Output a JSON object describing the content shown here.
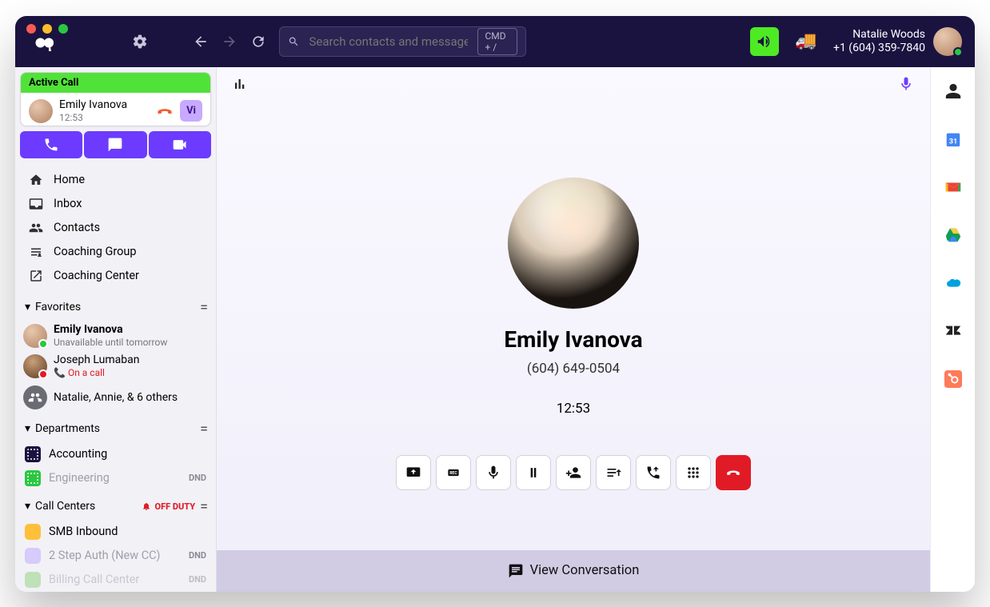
{
  "topbar": {
    "search_placeholder": "Search contacts and messages",
    "shortcut": "CMD + /",
    "user_name": "Natalie Woods",
    "user_phone": "+1 (604) 359-7840"
  },
  "active_call": {
    "header": "Active Call",
    "name": "Emily Ivanova",
    "duration": "12:53",
    "chip": "Vi"
  },
  "nav": {
    "home": "Home",
    "inbox": "Inbox",
    "contacts": "Contacts",
    "coaching_group": "Coaching Group",
    "coaching_center": "Coaching Center"
  },
  "sections": {
    "favorites": "Favorites",
    "departments": "Departments",
    "call_centers": "Call Centers",
    "off_duty": "OFF DUTY"
  },
  "favorites": [
    {
      "name": "Emily Ivanova",
      "sub": "Unavailable until tomorrow",
      "bold": true,
      "presence": "green"
    },
    {
      "name": "Joseph Lumaban",
      "sub": "On a call",
      "sub_red": true,
      "presence": "red"
    },
    {
      "name": "Natalie, Annie, & 6 others",
      "group": true
    }
  ],
  "departments": [
    {
      "name": "Accounting",
      "color": "#1a1340"
    },
    {
      "name": "Engineering",
      "color": "#29c840",
      "muted": true,
      "dnd": "DND"
    }
  ],
  "call_centers": [
    {
      "name": "SMB Inbound",
      "color": "#ffbf3a"
    },
    {
      "name": "2 Step Auth (New CC)",
      "color": "#d6cbfb",
      "dnd": "DND"
    },
    {
      "name": "Billing Call Center",
      "color": "#8bd17c",
      "dnd": "DND"
    }
  ],
  "main": {
    "name": "Emily Ivanova",
    "phone": "(604) 649-0504",
    "duration": "12:53",
    "view_conversation": "View Conversation"
  }
}
